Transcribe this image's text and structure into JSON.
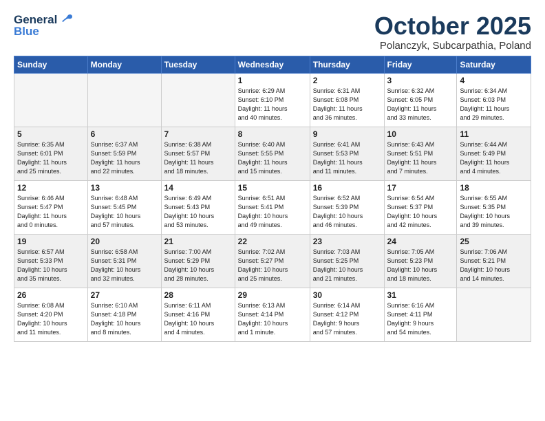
{
  "header": {
    "logo_general": "General",
    "logo_blue": "Blue",
    "month": "October 2025",
    "location": "Polanczyk, Subcarpathia, Poland"
  },
  "days_of_week": [
    "Sunday",
    "Monday",
    "Tuesday",
    "Wednesday",
    "Thursday",
    "Friday",
    "Saturday"
  ],
  "weeks": [
    [
      {
        "day": "",
        "info": ""
      },
      {
        "day": "",
        "info": ""
      },
      {
        "day": "",
        "info": ""
      },
      {
        "day": "1",
        "info": "Sunrise: 6:29 AM\nSunset: 6:10 PM\nDaylight: 11 hours\nand 40 minutes."
      },
      {
        "day": "2",
        "info": "Sunrise: 6:31 AM\nSunset: 6:08 PM\nDaylight: 11 hours\nand 36 minutes."
      },
      {
        "day": "3",
        "info": "Sunrise: 6:32 AM\nSunset: 6:05 PM\nDaylight: 11 hours\nand 33 minutes."
      },
      {
        "day": "4",
        "info": "Sunrise: 6:34 AM\nSunset: 6:03 PM\nDaylight: 11 hours\nand 29 minutes."
      }
    ],
    [
      {
        "day": "5",
        "info": "Sunrise: 6:35 AM\nSunset: 6:01 PM\nDaylight: 11 hours\nand 25 minutes."
      },
      {
        "day": "6",
        "info": "Sunrise: 6:37 AM\nSunset: 5:59 PM\nDaylight: 11 hours\nand 22 minutes."
      },
      {
        "day": "7",
        "info": "Sunrise: 6:38 AM\nSunset: 5:57 PM\nDaylight: 11 hours\nand 18 minutes."
      },
      {
        "day": "8",
        "info": "Sunrise: 6:40 AM\nSunset: 5:55 PM\nDaylight: 11 hours\nand 15 minutes."
      },
      {
        "day": "9",
        "info": "Sunrise: 6:41 AM\nSunset: 5:53 PM\nDaylight: 11 hours\nand 11 minutes."
      },
      {
        "day": "10",
        "info": "Sunrise: 6:43 AM\nSunset: 5:51 PM\nDaylight: 11 hours\nand 7 minutes."
      },
      {
        "day": "11",
        "info": "Sunrise: 6:44 AM\nSunset: 5:49 PM\nDaylight: 11 hours\nand 4 minutes."
      }
    ],
    [
      {
        "day": "12",
        "info": "Sunrise: 6:46 AM\nSunset: 5:47 PM\nDaylight: 11 hours\nand 0 minutes."
      },
      {
        "day": "13",
        "info": "Sunrise: 6:48 AM\nSunset: 5:45 PM\nDaylight: 10 hours\nand 57 minutes."
      },
      {
        "day": "14",
        "info": "Sunrise: 6:49 AM\nSunset: 5:43 PM\nDaylight: 10 hours\nand 53 minutes."
      },
      {
        "day": "15",
        "info": "Sunrise: 6:51 AM\nSunset: 5:41 PM\nDaylight: 10 hours\nand 49 minutes."
      },
      {
        "day": "16",
        "info": "Sunrise: 6:52 AM\nSunset: 5:39 PM\nDaylight: 10 hours\nand 46 minutes."
      },
      {
        "day": "17",
        "info": "Sunrise: 6:54 AM\nSunset: 5:37 PM\nDaylight: 10 hours\nand 42 minutes."
      },
      {
        "day": "18",
        "info": "Sunrise: 6:55 AM\nSunset: 5:35 PM\nDaylight: 10 hours\nand 39 minutes."
      }
    ],
    [
      {
        "day": "19",
        "info": "Sunrise: 6:57 AM\nSunset: 5:33 PM\nDaylight: 10 hours\nand 35 minutes."
      },
      {
        "day": "20",
        "info": "Sunrise: 6:58 AM\nSunset: 5:31 PM\nDaylight: 10 hours\nand 32 minutes."
      },
      {
        "day": "21",
        "info": "Sunrise: 7:00 AM\nSunset: 5:29 PM\nDaylight: 10 hours\nand 28 minutes."
      },
      {
        "day": "22",
        "info": "Sunrise: 7:02 AM\nSunset: 5:27 PM\nDaylight: 10 hours\nand 25 minutes."
      },
      {
        "day": "23",
        "info": "Sunrise: 7:03 AM\nSunset: 5:25 PM\nDaylight: 10 hours\nand 21 minutes."
      },
      {
        "day": "24",
        "info": "Sunrise: 7:05 AM\nSunset: 5:23 PM\nDaylight: 10 hours\nand 18 minutes."
      },
      {
        "day": "25",
        "info": "Sunrise: 7:06 AM\nSunset: 5:21 PM\nDaylight: 10 hours\nand 14 minutes."
      }
    ],
    [
      {
        "day": "26",
        "info": "Sunrise: 6:08 AM\nSunset: 4:20 PM\nDaylight: 10 hours\nand 11 minutes."
      },
      {
        "day": "27",
        "info": "Sunrise: 6:10 AM\nSunset: 4:18 PM\nDaylight: 10 hours\nand 8 minutes."
      },
      {
        "day": "28",
        "info": "Sunrise: 6:11 AM\nSunset: 4:16 PM\nDaylight: 10 hours\nand 4 minutes."
      },
      {
        "day": "29",
        "info": "Sunrise: 6:13 AM\nSunset: 4:14 PM\nDaylight: 10 hours\nand 1 minute."
      },
      {
        "day": "30",
        "info": "Sunrise: 6:14 AM\nSunset: 4:12 PM\nDaylight: 9 hours\nand 57 minutes."
      },
      {
        "day": "31",
        "info": "Sunrise: 6:16 AM\nSunset: 4:11 PM\nDaylight: 9 hours\nand 54 minutes."
      },
      {
        "day": "",
        "info": ""
      }
    ]
  ]
}
